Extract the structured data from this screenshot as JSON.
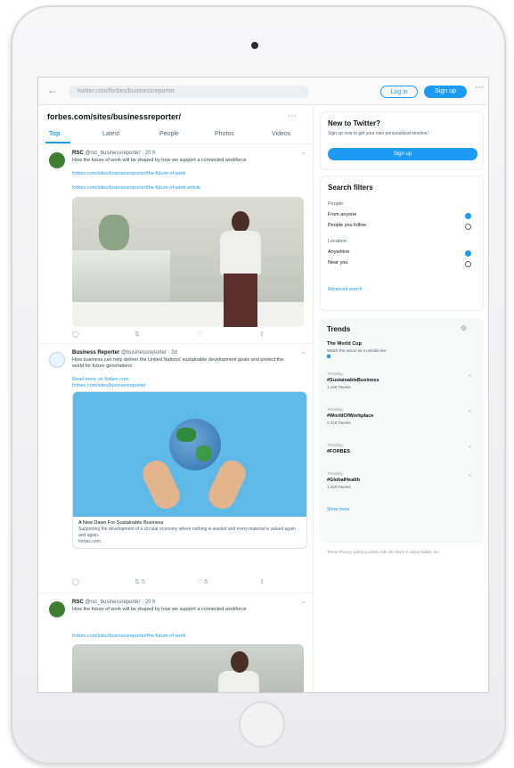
{
  "browser": {
    "url": "twitter.com/forbes/businessreporter",
    "login_label": "Log in",
    "signup_label": "Sign up",
    "more_icon": "more-horizontal-icon",
    "back_icon": "back-arrow-icon"
  },
  "search": {
    "title": "forbes.com/sites/businessreporter/",
    "tabs": [
      {
        "label": "Top",
        "active": true
      },
      {
        "label": "Latest"
      },
      {
        "label": "People"
      },
      {
        "label": "Photos"
      },
      {
        "label": "Videos"
      }
    ]
  },
  "tweets": [
    {
      "author": "RSC",
      "handle": "@rsc_businessreporter · 20 h",
      "text": "How the future of work will be shaped by how we support a connected workforce",
      "link": "forbes.com/sites/businessreporter/the-future-of-work",
      "link2": "forbes.com/sites/businessreporter/the-future-of-work-article",
      "actions": [
        "",
        "",
        "",
        ""
      ]
    },
    {
      "author": "Business Reporter",
      "handle": "@businessreporter · 2d",
      "text": "How business can help deliver the United Nations' sustainable development goals and protect the world for future generations",
      "link": "Read more on forbes.com",
      "link2": "forbes.com/sites/businessreporter",
      "card_title": "A New Dawn For Sustainable Business",
      "card_desc": "Supporting the development of a circular economy where nothing is wasted and every material is valued again and again.",
      "card_domain": "forbes.com",
      "actions": [
        "",
        "5",
        "6",
        ""
      ]
    },
    {
      "author": "RSC",
      "handle": "@rsc_businessreporter · 20 h",
      "text": "How the future of work will be shaped by how we support a connected workforce",
      "link": "forbes.com/sites/businessreporter/the-future-of-work"
    }
  ],
  "sidebar": {
    "new_title": "New to Twitter?",
    "new_sub": "Sign up now to get your own personalized timeline!",
    "signup_label": "Sign up",
    "filters_title": "Search filters",
    "people_label": "People",
    "people_opts": [
      "From anyone",
      "People you follow"
    ],
    "location_label": "Location",
    "location_opts": [
      "Anywhere",
      "Near you"
    ],
    "advanced_label": "Advanced search",
    "trends_title": "Trends",
    "trends": [
      {
        "meta": "",
        "name": "The World Cup",
        "sub": "Watch the action as it unfolds live"
      },
      {
        "meta": "Trending",
        "name": "#SustainableBusiness",
        "sub": "1,126 Tweets"
      },
      {
        "meta": "Trending",
        "name": "#WorldOfWorkplace",
        "sub": "2,418 Tweets"
      },
      {
        "meta": "Trending",
        "name": "#FORBES",
        "sub": ""
      },
      {
        "meta": "Trending",
        "name": "#GlobalHealth",
        "sub": "1,420 Tweets"
      }
    ],
    "show_more": "Show more",
    "footer": "Terms  Privacy policy  Cookies  Ads info  More  © 2019 Twitter, Inc."
  }
}
